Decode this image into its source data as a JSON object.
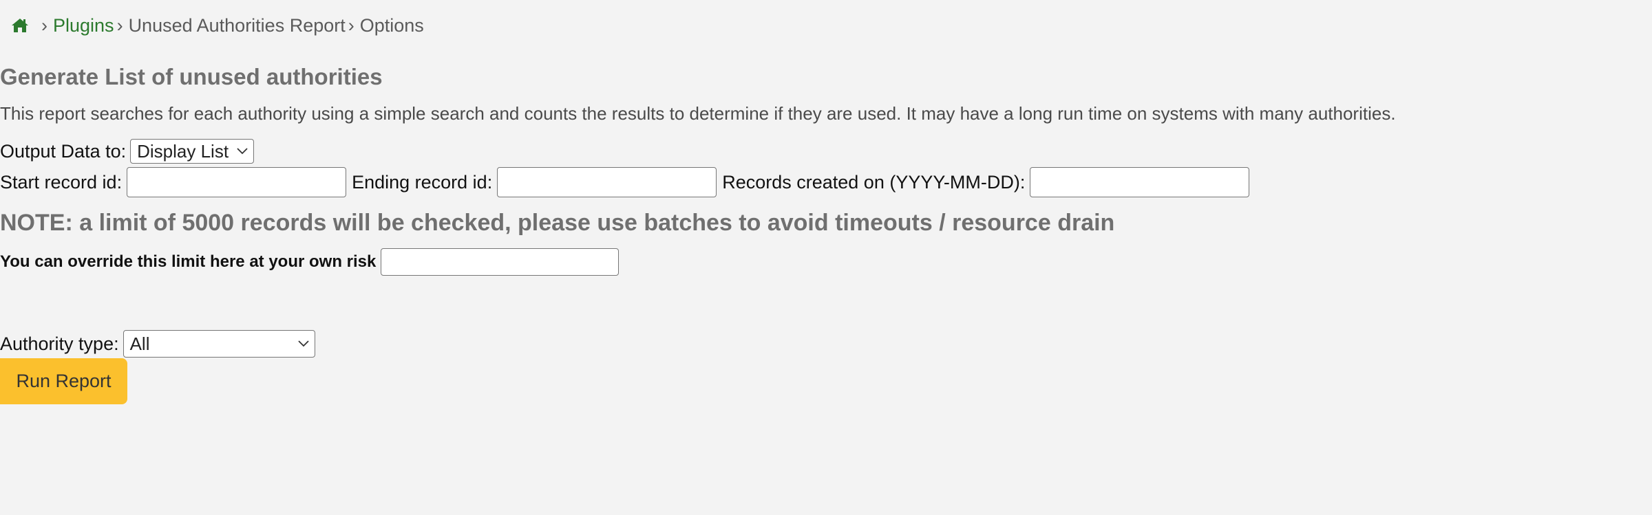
{
  "breadcrumb": {
    "home_icon": "home-icon",
    "separator": "›",
    "items": [
      {
        "label": "Plugins",
        "link": true
      },
      {
        "label": "Unused Authorities Report",
        "link": false
      },
      {
        "label": "Options",
        "link": false
      }
    ]
  },
  "heading": "Generate List of unused authorities",
  "description": "This report searches for each authority using a simple search and counts the results to determine if they are used. It may have a long run time on systems with many authorities.",
  "output": {
    "label": "Output Data to:",
    "selected": "Display List"
  },
  "records": {
    "start_label": "Start record id:",
    "start_value": "",
    "end_label": "Ending record id:",
    "end_value": "",
    "created_label": "Records created on (YYYY-MM-DD):",
    "created_value": ""
  },
  "note": "NOTE: a limit of 5000 records will be checked, please use batches to avoid timeouts / resource drain",
  "override": {
    "label": "You can override this limit here at your own risk",
    "value": ""
  },
  "authority": {
    "label": "Authority type:",
    "selected": "All"
  },
  "run_button": "Run Report",
  "colors": {
    "background": "#f3f3f3",
    "link": "#2c7a2e",
    "button": "#fbc02d",
    "heading": "#6f6f6f"
  }
}
